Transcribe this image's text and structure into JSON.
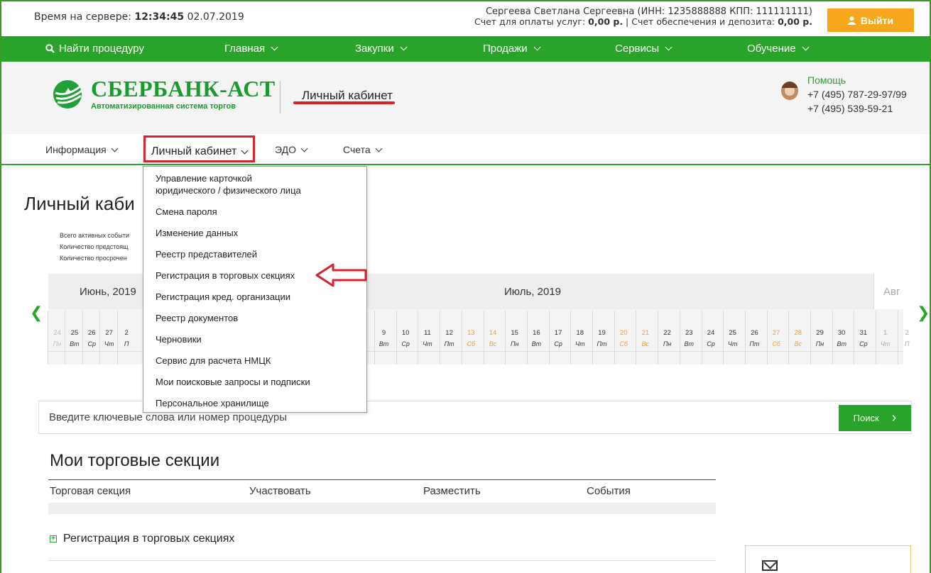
{
  "topbar": {
    "server_time_label": "Время на сервере:",
    "server_time": "12:34:45",
    "server_date": "02.07.2019",
    "account_line1": "Сергеева Светлана Сергеевна (ИНН: 1235888888 КПП: 111111111)",
    "account_line2_prefix": "Счет для оплаты услуг:",
    "account_services_balance": "0,00 р.",
    "account_line2_mid": "| Счет обеспечения и депозита:",
    "account_deposit_balance": "0,00 р.",
    "logout_label": "Выйти"
  },
  "main_nav": {
    "search": "Найти процедуру",
    "home": "Главная",
    "purchases": "Закупки",
    "sales": "Продажи",
    "services": "Сервисы",
    "education": "Обучение"
  },
  "header": {
    "logo_title": "СБЕРБАНК-АСТ",
    "logo_subtitle": "Автоматизированная система торгов",
    "section_title": "Личный кабинет",
    "help_label": "Помощь",
    "phone1": "+7 (495) 787-29-97/99",
    "phone2": "+7 (495) 539-59-21"
  },
  "sub_nav": {
    "info": "Информация",
    "cabinet": "Личный кабинет",
    "edo": "ЭДО",
    "accounts": "Счета"
  },
  "dropdown": {
    "items": [
      "Управление карточкой",
      "юридического / физического лица",
      "Смена пароля",
      "Изменение данных",
      "Реестр представителей",
      "Регистрация в торговых секциях",
      "Регистрация кред. организации",
      "Реестр документов",
      "Черновики",
      "Сервис для расчета НМЦК",
      "Мои поисковые запросы и подписки",
      "Персональное хранилище"
    ]
  },
  "page": {
    "title": "Личный каби",
    "stats": [
      "Всего активных событи",
      "Количество предстоящ",
      "Количество просрочен"
    ]
  },
  "calendar": {
    "month_prev": "Июнь, 2019",
    "month_current": "Июль, 2019",
    "month_next": "Авг",
    "days_left": [
      "24",
      "25",
      "26",
      "27",
      "2"
    ],
    "weekdays_left": [
      "Пн",
      "Вт",
      "Ср",
      "Чт",
      "П"
    ],
    "days_right": [
      "9",
      "10",
      "11",
      "12",
      "13",
      "14",
      "15",
      "16",
      "17",
      "18",
      "19",
      "20",
      "21",
      "22",
      "23",
      "24",
      "25",
      "26",
      "27",
      "28",
      "29",
      "30",
      "31",
      "1",
      "2"
    ],
    "weekdays_right": [
      "Вт",
      "Ср",
      "Чт",
      "Пт",
      "Сб",
      "Вс",
      "Пн",
      "Вт",
      "Ср",
      "Чт",
      "Пт",
      "Сб",
      "Вс",
      "Пн",
      "Вт",
      "Ср",
      "Чт",
      "Пт",
      "Сб",
      "Вс",
      "Пн",
      "Вт",
      "Ср",
      "Чт",
      "П"
    ],
    "weekend_color": "#f0a030"
  },
  "search": {
    "placeholder": "Введите ключевые слова или номер процедуры",
    "button_label": "Поиск"
  },
  "sections": {
    "title": "Мои торговые секции",
    "columns": [
      "Торговая секция",
      "Участвовать",
      "Разместить",
      "События"
    ],
    "registration_link": "Регистрация в торговых секциях"
  },
  "colors": {
    "brand_green": "#2aa32a",
    "highlight_red": "#d8232a",
    "logout_orange": "#f6a71d"
  }
}
